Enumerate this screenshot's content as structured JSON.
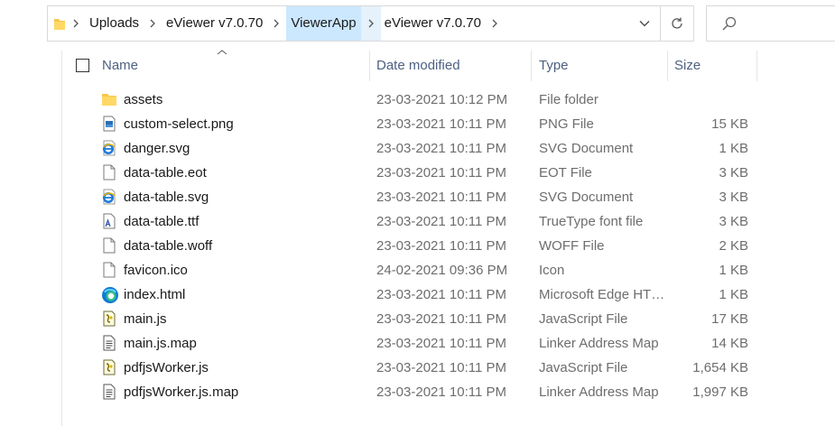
{
  "address_bar": {
    "breadcrumbs": [
      "Uploads",
      "eViewer v7.0.70",
      "ViewerApp",
      "eViewer v7.0.70"
    ]
  },
  "columns": {
    "name": "Name",
    "date_modified": "Date modified",
    "type": "Type",
    "size": "Size"
  },
  "files": [
    {
      "name": "assets",
      "date": "23-03-2021 10:12 PM",
      "type": "File folder",
      "size": "",
      "icon": "folder-icon"
    },
    {
      "name": "custom-select.png",
      "date": "23-03-2021 10:11 PM",
      "type": "PNG File",
      "size": "15 KB",
      "icon": "png-file-icon"
    },
    {
      "name": "danger.svg",
      "date": "23-03-2021 10:11 PM",
      "type": "SVG Document",
      "size": "1 KB",
      "icon": "svg-file-icon"
    },
    {
      "name": "data-table.eot",
      "date": "23-03-2021 10:11 PM",
      "type": "EOT File",
      "size": "3 KB",
      "icon": "blank-file-icon"
    },
    {
      "name": "data-table.svg",
      "date": "23-03-2021 10:11 PM",
      "type": "SVG Document",
      "size": "3 KB",
      "icon": "svg-file-icon"
    },
    {
      "name": "data-table.ttf",
      "date": "23-03-2021 10:11 PM",
      "type": "TrueType font file",
      "size": "3 KB",
      "icon": "font-file-icon"
    },
    {
      "name": "data-table.woff",
      "date": "23-03-2021 10:11 PM",
      "type": "WOFF File",
      "size": "2 KB",
      "icon": "blank-file-icon"
    },
    {
      "name": "favicon.ico",
      "date": "24-02-2021 09:36 PM",
      "type": "Icon",
      "size": "1 KB",
      "icon": "blank-file-icon"
    },
    {
      "name": "index.html",
      "date": "23-03-2021 10:11 PM",
      "type": "Microsoft Edge HT…",
      "size": "1 KB",
      "icon": "edge-icon"
    },
    {
      "name": "main.js",
      "date": "23-03-2021 10:11 PM",
      "type": "JavaScript File",
      "size": "17 KB",
      "icon": "js-file-icon"
    },
    {
      "name": "main.js.map",
      "date": "23-03-2021 10:11 PM",
      "type": "Linker Address Map",
      "size": "14 KB",
      "icon": "text-file-icon"
    },
    {
      "name": "pdfjsWorker.js",
      "date": "23-03-2021 10:11 PM",
      "type": "JavaScript File",
      "size": "1,654 KB",
      "icon": "js-file-icon"
    },
    {
      "name": "pdfjsWorker.js.map",
      "date": "23-03-2021 10:11 PM",
      "type": "Linker Address Map",
      "size": "1,997 KB",
      "icon": "text-file-icon"
    }
  ]
}
